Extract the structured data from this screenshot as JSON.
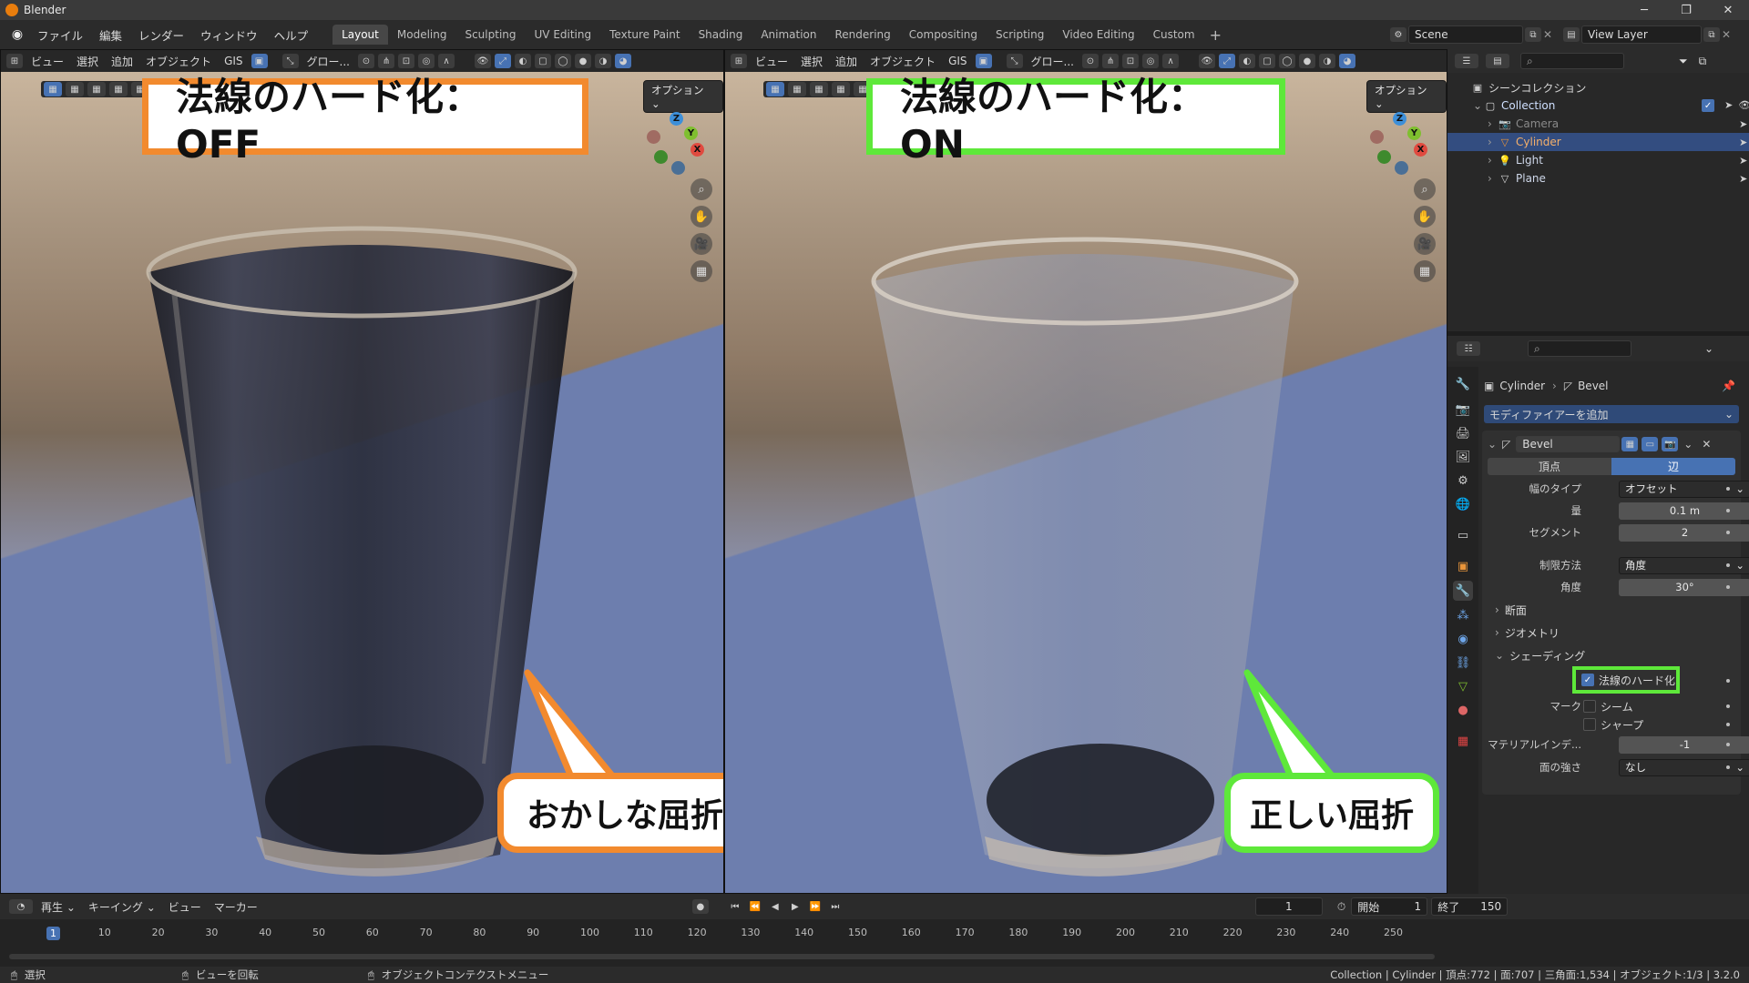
{
  "window": {
    "title": "Blender"
  },
  "menu": [
    "ファイル",
    "編集",
    "レンダー",
    "ウィンドウ",
    "ヘルプ"
  ],
  "workspaces": [
    "Layout",
    "Modeling",
    "Sculpting",
    "UV Editing",
    "Texture Paint",
    "Shading",
    "Animation",
    "Rendering",
    "Compositing",
    "Scripting",
    "Video Editing",
    "Custom"
  ],
  "active_workspace": "Layout",
  "scene": "Scene",
  "view_layer": "View Layer",
  "viewport_menu": [
    "ビュー",
    "選択",
    "追加",
    "オブジェクト",
    "GIS"
  ],
  "transform_orientation": "グロー...",
  "options_label": "オプション",
  "left_viewport": {
    "label": "法線のハード化：OFF",
    "bubble": "おかしな屈折",
    "color": "#f28a2e"
  },
  "right_viewport": {
    "label": "法線のハード化：ON",
    "bubble": "正しい屈折",
    "color": "#5ee83a"
  },
  "gizmo": {
    "x": "X",
    "y": "Y",
    "z": "Z"
  },
  "outliner": {
    "root": "シーンコレクション",
    "collection": "Collection",
    "items": [
      {
        "name": "Camera",
        "icon": "camera-icon",
        "color": "#8c6e5a"
      },
      {
        "name": "Cylinder",
        "icon": "mesh-icon",
        "color": "#e9953a",
        "selected": true
      },
      {
        "name": "Light",
        "icon": "light-icon",
        "color": "#d9d9d9"
      },
      {
        "name": "Plane",
        "icon": "mesh-icon",
        "color": "#d9d9d9"
      }
    ]
  },
  "properties": {
    "breadcrumb_object": "Cylinder",
    "breadcrumb_modifier": "Bevel",
    "add_modifier": "モディファイアーを追加",
    "modifier_name": "Bevel",
    "tabs": [
      "頂点",
      "辺"
    ],
    "active_tab": "辺",
    "width_type_label": "幅のタイプ",
    "width_type_value": "オフセット",
    "amount_label": "量",
    "amount_value": "0.1 m",
    "segments_label": "セグメント",
    "segments_value": "2",
    "limit_method_label": "制限方法",
    "limit_method_value": "角度",
    "angle_label": "角度",
    "angle_value": "30°",
    "section_profile": "断面",
    "section_geometry": "ジオメトリ",
    "section_shading": "シェーディング",
    "harden_normals_label": "法線のハード化",
    "harden_normals_checked": true,
    "mark_label": "マーク",
    "mark_seam": "シーム",
    "mark_sharp": "シャープ",
    "material_index_label": "マテリアルインデ...",
    "material_index_value": "-1",
    "face_strength_label": "面の強さ",
    "face_strength_value": "なし"
  },
  "timeline": {
    "menu": [
      "再生",
      "キーイング",
      "ビュー",
      "マーカー"
    ],
    "current_frame": "1",
    "start_label": "開始",
    "start_value": "1",
    "end_label": "終了",
    "end_value": "150",
    "ticks": [
      "1",
      "10",
      "20",
      "30",
      "40",
      "50",
      "60",
      "70",
      "80",
      "90",
      "100",
      "110",
      "120",
      "130",
      "140",
      "150",
      "160",
      "170",
      "180",
      "190",
      "200",
      "210",
      "220",
      "230",
      "240",
      "250"
    ]
  },
  "statusbar": {
    "select": "選択",
    "rotate_view": "ビューを回転",
    "context_menu": "オブジェクトコンテクストメニュー",
    "info": "Collection | Cylinder | 頂点:772 | 面:707 | 三角面:1,534 | オブジェクト:1/3 | 3.2.0"
  }
}
